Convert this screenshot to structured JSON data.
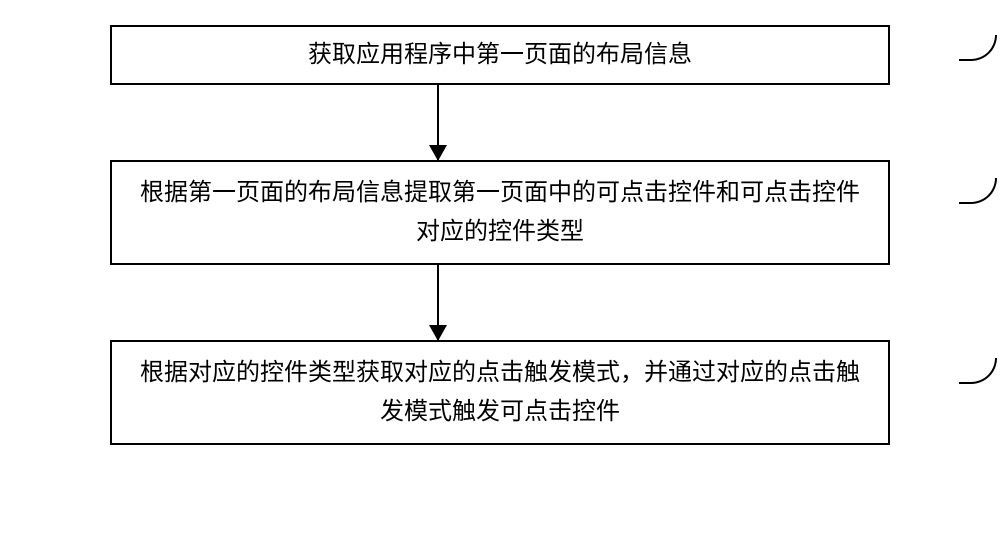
{
  "chart_data": {
    "type": "flowchart",
    "steps": [
      {
        "id": "S101",
        "text": "获取应用程序中第一页面的布局信息",
        "multiline": false
      },
      {
        "id": "S102",
        "text": "根据第一页面的布局信息提取第一页面中的可点击控件和可点击控件对应的控件类型",
        "multiline": true
      },
      {
        "id": "S103",
        "text": "根据对应的控件类型获取对应的点击触发模式，并通过对应的点击触发模式触发可点击控件",
        "multiline": true
      }
    ]
  }
}
